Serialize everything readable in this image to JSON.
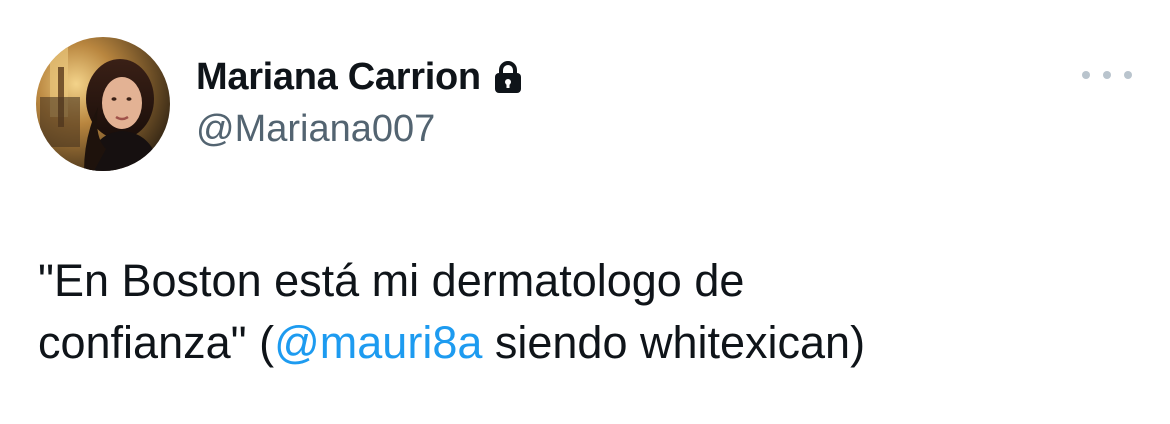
{
  "author": {
    "display_name": "Mariana Carrion",
    "handle": "@Mariana007",
    "protected_icon": "lock-icon",
    "avatar_icon": "profile-photo"
  },
  "menu": {
    "icon": "more-horizontal-icon"
  },
  "tweet": {
    "line1": "\"En Boston está mi dermatologo de",
    "line2_before": "confianza\" (",
    "mention": "@mauri8a",
    "line2_after": " siendo whitexican)"
  },
  "colors": {
    "text": "#0f1419",
    "secondary": "#536471",
    "link": "#1d9bf0"
  }
}
